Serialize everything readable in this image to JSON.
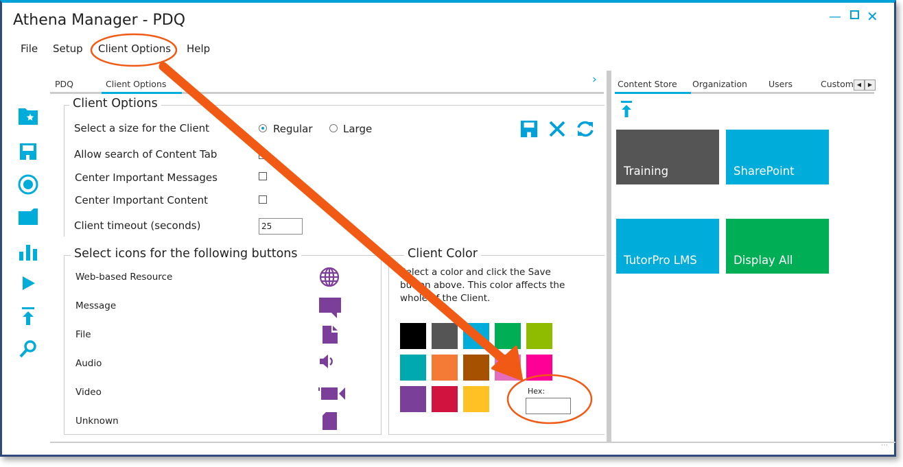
{
  "window": {
    "title": "Athena Manager - PDQ",
    "controls": [
      "minimize-icon",
      "maximize-icon",
      "close-icon"
    ],
    "accent": "#00a0d8"
  },
  "menu": [
    "File",
    "Setup",
    "Client Options",
    "Help"
  ],
  "left_tabs": {
    "items": [
      "PDQ",
      "Client Options"
    ],
    "active": 1
  },
  "right_tabs": {
    "items": [
      "Content Store",
      "Organization",
      "Users",
      "Custom"
    ],
    "active": 0
  },
  "sidebar_icons": [
    "folder-star-icon",
    "save-icon",
    "record-icon",
    "folder-icon",
    "bar-chart-icon",
    "play-icon",
    "upload-icon",
    "search-icon"
  ],
  "client_options": {
    "legend": "Client Options",
    "size_label": "Select a size for the Client",
    "size_options": [
      "Regular",
      "Large"
    ],
    "size_selected": "Regular",
    "allow_search": {
      "label": "Allow search of Content Tab",
      "checked": false
    },
    "center_messages": {
      "label": "Center Important Messages",
      "checked": false
    },
    "center_content": {
      "label": "Center Important Content",
      "checked": false
    },
    "timeout": {
      "label": "Client timeout (seconds)",
      "value": "25"
    },
    "actions": [
      "save-icon",
      "cancel-icon",
      "refresh-icon"
    ]
  },
  "icons_section": {
    "legend": "Select icons for the following buttons",
    "items": [
      {
        "label": "Web-based Resource",
        "icon": "globe-icon"
      },
      {
        "label": "Message",
        "icon": "message-icon"
      },
      {
        "label": "File",
        "icon": "file-icon"
      },
      {
        "label": "Audio",
        "icon": "audio-icon"
      },
      {
        "label": "Video",
        "icon": "video-icon"
      },
      {
        "label": "Unknown",
        "icon": "unknown-icon"
      }
    ],
    "icon_color": "#7b3f99"
  },
  "client_color": {
    "legend": "Client Color",
    "description": "Select a color and click the Save button above. This color affects the whole of the Client.",
    "swatches": [
      "#000000",
      "#555555",
      "#00acd9",
      "#00ae55",
      "#8fbc00",
      "#00a9ad",
      "#f47b36",
      "#a65100",
      "#e46dbd",
      "#ff0097",
      "#7a3f98",
      "#d0133f",
      "#ffc124"
    ],
    "hex_label": "Hex:",
    "hex_value": ""
  },
  "tiles": [
    {
      "label": "Training",
      "color": "#555555"
    },
    {
      "label": "SharePoint",
      "color": "#00acd9"
    },
    {
      "label": "TutorPro LMS",
      "color": "#00acd9"
    },
    {
      "label": "Display All",
      "color": "#00ae55"
    }
  ],
  "annotation_color": "#f05a14"
}
